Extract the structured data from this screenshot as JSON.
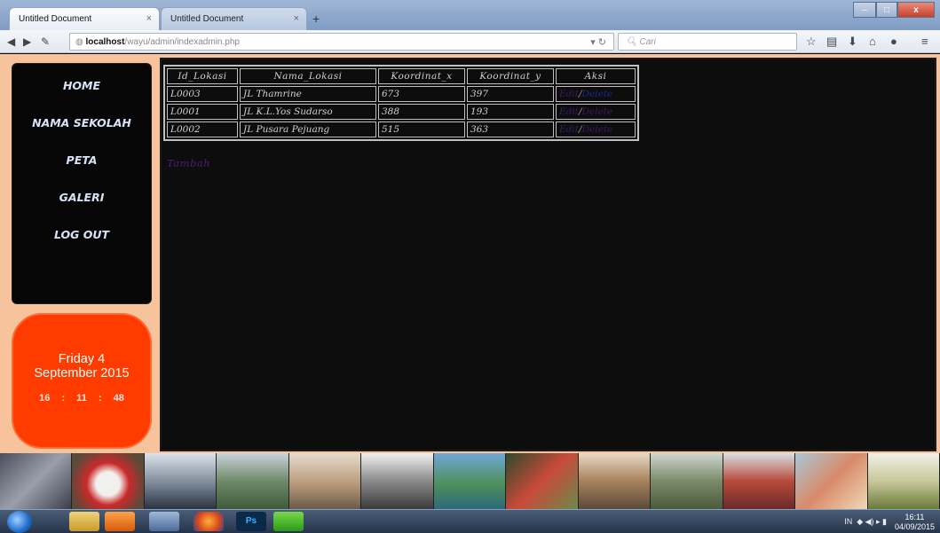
{
  "browser": {
    "tabs": [
      {
        "label": "Untitled Document",
        "active": true
      },
      {
        "label": "Untitled Document",
        "active": false
      }
    ],
    "new_tab": "+",
    "close_glyph": "×",
    "url_host": "localhost",
    "url_path": "/wayu/admin/indexadmin.php",
    "search_placeholder": "Cari"
  },
  "menu": {
    "items": [
      {
        "label": "HOME"
      },
      {
        "label": "NAMA SEKOLAH"
      },
      {
        "label": "PETA"
      },
      {
        "label": "GALERI"
      },
      {
        "label": "LOG OUT"
      }
    ]
  },
  "clock": {
    "day": "Friday 4",
    "month_year": "September 2015",
    "time": "16 : 11 : 48"
  },
  "table": {
    "headers": [
      "Id_Lokasi",
      "Nama_Lokasi",
      "Koordinat_x",
      "Koordinat_y",
      "Aksi"
    ],
    "rows": [
      {
        "id": "L0003",
        "nama": "JL Thamrine",
        "x": "673",
        "y": "397"
      },
      {
        "id": "L0001",
        "nama": "JL K.L.Yos Sudarso",
        "x": "388",
        "y": "193"
      },
      {
        "id": "L0002",
        "nama": "JL Pusara Pejuang",
        "x": "515",
        "y": "363"
      }
    ],
    "edit_label": "Edit",
    "separator": "/",
    "delete_label": "Delete"
  },
  "tambah_label": "Tambah",
  "taskbar": {
    "ps_label": "Ps",
    "lang": "IN",
    "time": "16:11",
    "date": "04/09/2015"
  },
  "colors": {
    "page_bg": "#f7c39c",
    "menu_text": "#d7e3f5",
    "clock_bg": "#ff3b00",
    "edit_link": "#3a1a63",
    "delete_link": "#1a2a8a",
    "tambah_link": "#4b1f78"
  }
}
